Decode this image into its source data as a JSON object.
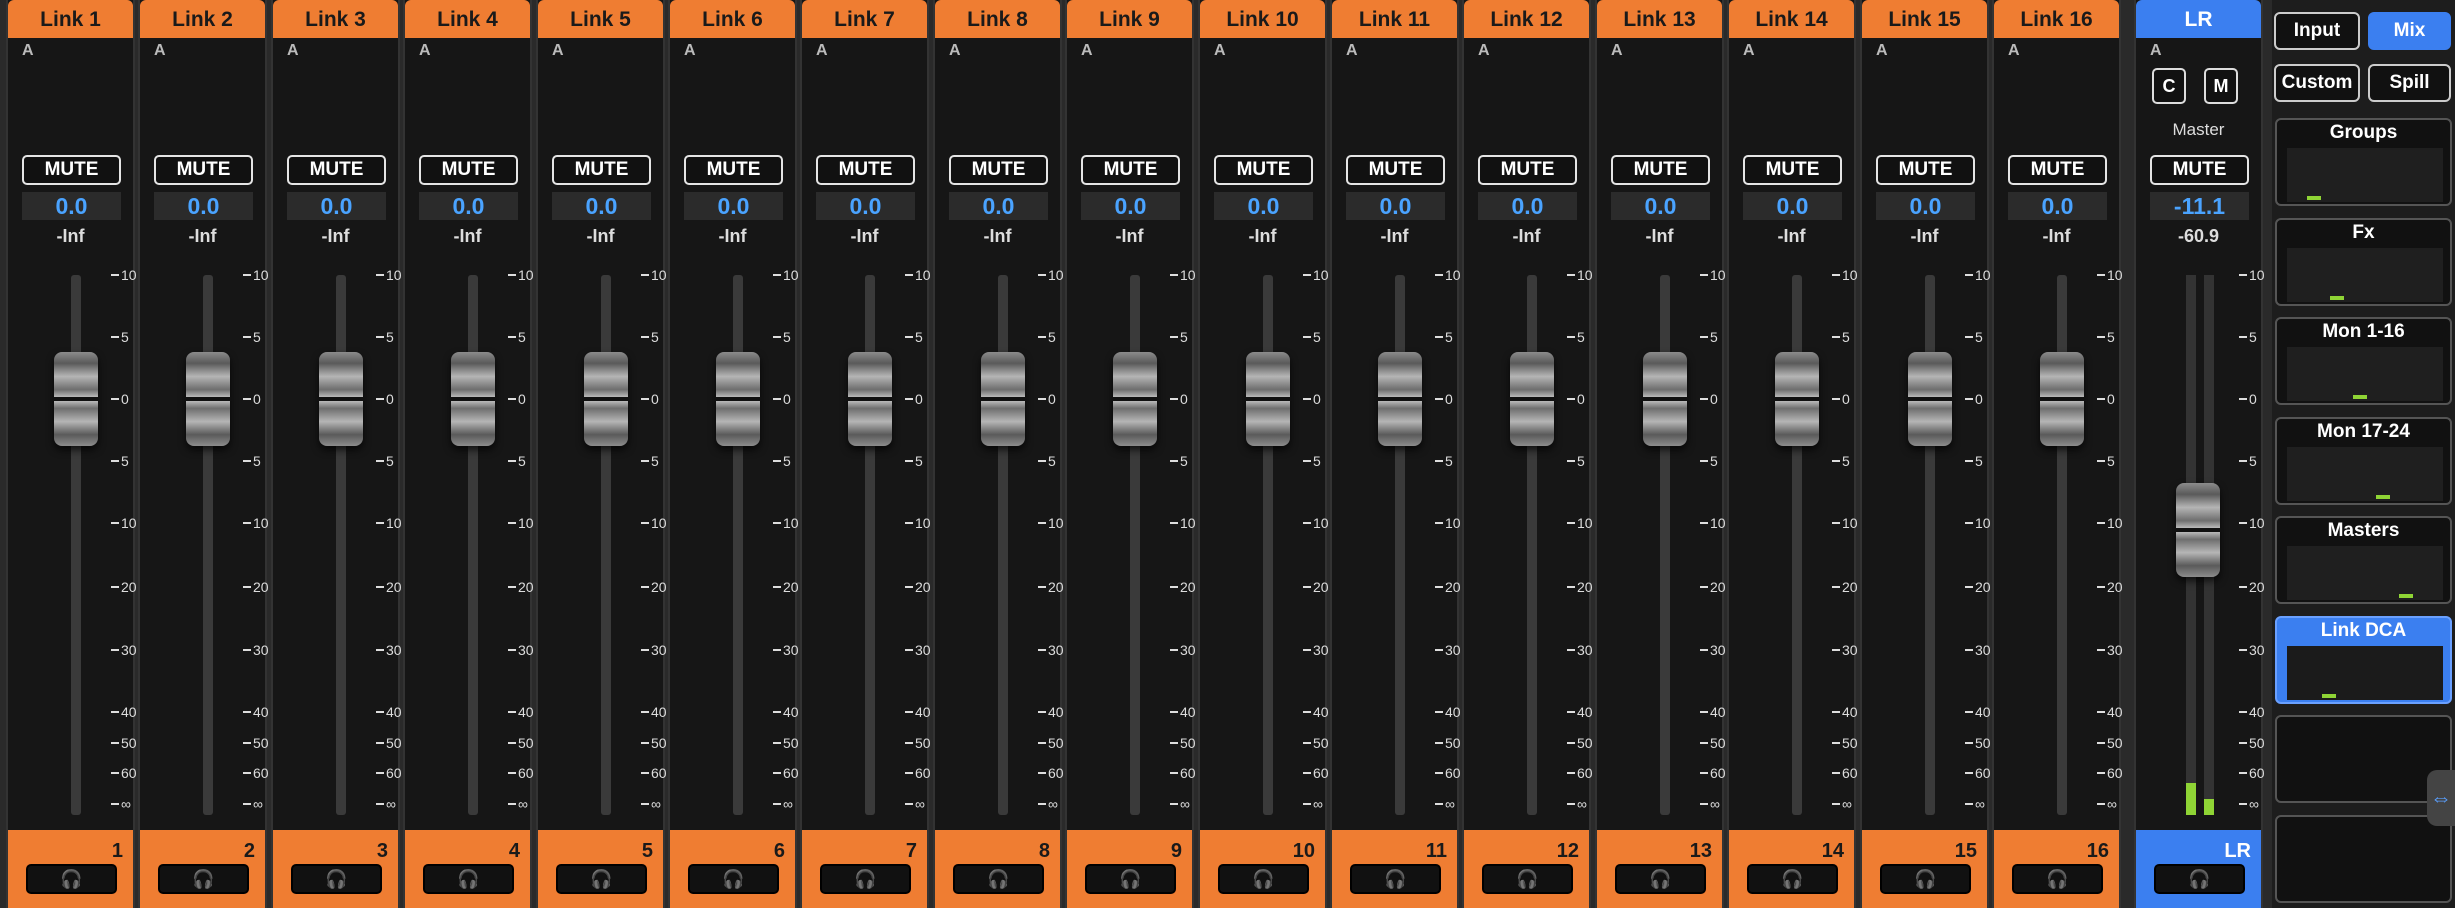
{
  "channels": [
    {
      "name": "Link 1",
      "number": "1",
      "auto_label": "A",
      "mute_label": "MUTE",
      "gain": "0.0",
      "level": "-Inf"
    },
    {
      "name": "Link 2",
      "number": "2",
      "auto_label": "A",
      "mute_label": "MUTE",
      "gain": "0.0",
      "level": "-Inf"
    },
    {
      "name": "Link 3",
      "number": "3",
      "auto_label": "A",
      "mute_label": "MUTE",
      "gain": "0.0",
      "level": "-Inf"
    },
    {
      "name": "Link 4",
      "number": "4",
      "auto_label": "A",
      "mute_label": "MUTE",
      "gain": "0.0",
      "level": "-Inf"
    },
    {
      "name": "Link 5",
      "number": "5",
      "auto_label": "A",
      "mute_label": "MUTE",
      "gain": "0.0",
      "level": "-Inf"
    },
    {
      "name": "Link 6",
      "number": "6",
      "auto_label": "A",
      "mute_label": "MUTE",
      "gain": "0.0",
      "level": "-Inf"
    },
    {
      "name": "Link 7",
      "number": "7",
      "auto_label": "A",
      "mute_label": "MUTE",
      "gain": "0.0",
      "level": "-Inf"
    },
    {
      "name": "Link 8",
      "number": "8",
      "auto_label": "A",
      "mute_label": "MUTE",
      "gain": "0.0",
      "level": "-Inf"
    },
    {
      "name": "Link 9",
      "number": "9",
      "auto_label": "A",
      "mute_label": "MUTE",
      "gain": "0.0",
      "level": "-Inf"
    },
    {
      "name": "Link 10",
      "number": "10",
      "auto_label": "A",
      "mute_label": "MUTE",
      "gain": "0.0",
      "level": "-Inf"
    },
    {
      "name": "Link 11",
      "number": "11",
      "auto_label": "A",
      "mute_label": "MUTE",
      "gain": "0.0",
      "level": "-Inf"
    },
    {
      "name": "Link 12",
      "number": "12",
      "auto_label": "A",
      "mute_label": "MUTE",
      "gain": "0.0",
      "level": "-Inf"
    },
    {
      "name": "Link 13",
      "number": "13",
      "auto_label": "A",
      "mute_label": "MUTE",
      "gain": "0.0",
      "level": "-Inf"
    },
    {
      "name": "Link 14",
      "number": "14",
      "auto_label": "A",
      "mute_label": "MUTE",
      "gain": "0.0",
      "level": "-Inf"
    },
    {
      "name": "Link 15",
      "number": "15",
      "auto_label": "A",
      "mute_label": "MUTE",
      "gain": "0.0",
      "level": "-Inf"
    },
    {
      "name": "Link 16",
      "number": "16",
      "auto_label": "A",
      "mute_label": "MUTE",
      "gain": "0.0",
      "level": "-Inf"
    }
  ],
  "master": {
    "name": "LR",
    "number": "LR",
    "auto_label": "A",
    "c_label": "C",
    "m_label": "M",
    "sub_label": "Master",
    "mute_label": "MUTE",
    "gain": "-11.1",
    "level": "-60.9",
    "fader_db": -11.1,
    "meter_levels": [
      0.06,
      0.03
    ]
  },
  "scale_labels": [
    "10",
    "5",
    "0",
    "5",
    "10",
    "20",
    "30",
    "40",
    "50",
    "60",
    "∞"
  ],
  "scale_db": [
    10,
    5,
    0,
    -5,
    -10,
    -20,
    -30,
    -40,
    -50,
    -60,
    -90
  ],
  "solo_icon": "headphones-icon",
  "solo_glyph": "🎧",
  "sidebar": {
    "input_label": "Input",
    "mix_label": "Mix",
    "custom_label": "Custom",
    "spill_label": "Spill",
    "layers": [
      {
        "title": "Groups",
        "active": false
      },
      {
        "title": "Fx",
        "active": false
      },
      {
        "title": "Mon 1-16",
        "active": false
      },
      {
        "title": "Mon 17-24",
        "active": false
      },
      {
        "title": "Masters",
        "active": false
      },
      {
        "title": "Link DCA",
        "active": true
      },
      {
        "title": "",
        "active": false
      },
      {
        "title": "",
        "active": false
      }
    ]
  },
  "colors": {
    "channel": "#ef7d32",
    "master": "#3b7ff0",
    "gain_text": "#4aa3ff",
    "meter": "#8fd435"
  }
}
